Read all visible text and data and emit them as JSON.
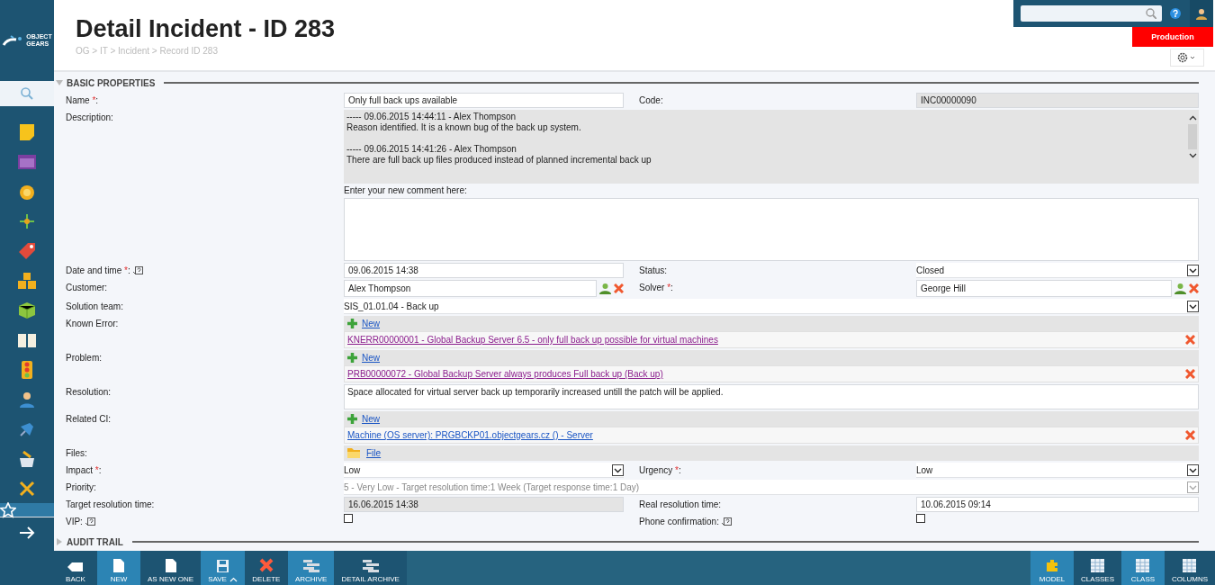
{
  "logo": [
    "OBJECT",
    "GEARS"
  ],
  "header": {
    "title": "Detail Incident - ID 283",
    "breadcrumb": "OG > IT > Incident > Record ID 283",
    "environment": "Production"
  },
  "sidebar_items": [
    {
      "kind": "note",
      "selected": false
    },
    {
      "kind": "window",
      "selected": false
    },
    {
      "kind": "badge",
      "selected": false
    },
    {
      "kind": "network",
      "selected": false
    },
    {
      "kind": "tag",
      "selected": false
    },
    {
      "kind": "boxes",
      "selected": false
    },
    {
      "kind": "cube",
      "selected": false
    },
    {
      "kind": "book",
      "selected": false
    },
    {
      "kind": "traffic",
      "selected": false
    },
    {
      "kind": "person",
      "selected": false
    },
    {
      "kind": "pin",
      "selected": false
    },
    {
      "kind": "tray",
      "selected": false
    },
    {
      "kind": "tools",
      "selected": false
    },
    {
      "kind": "star",
      "selected": true
    },
    {
      "kind": "arrow",
      "selected": false
    }
  ],
  "sections": [
    {
      "title": "BASIC PROPERTIES",
      "expanded": true
    },
    {
      "title": "AUDIT TRAIL",
      "expanded": false
    }
  ],
  "rows": [
    {
      "kind": "pair",
      "fields": [
        {
          "label_parts": [
            {
              "kind": "text",
              "text": "Name "
            },
            {
              "kind": "required",
              "text": "*"
            },
            {
              "kind": "text",
              "text": ":"
            }
          ],
          "kind": "text",
          "value": "Only full back ups available"
        },
        {
          "label_parts": [
            {
              "kind": "text",
              "text": "Code:"
            }
          ],
          "kind": "readonly",
          "value": "INC00000090"
        }
      ]
    },
    {
      "kind": "wide",
      "fields": [
        {
          "label_parts": [
            {
              "kind": "text",
              "text": "Description:"
            }
          ],
          "kind": "history",
          "entries": [
            {
              "header": "----- 09.06.2015 14:44:11 - Alex Thompson",
              "text": "Reason identified. It is a known bug of the back up system."
            },
            {
              "header": "----- 09.06.2015 14:41:26 - Alex Thompson",
              "text": "There are full back up files produced instead of planned incremental back up"
            }
          ],
          "comment_label": "Enter your new comment here:"
        }
      ]
    },
    {
      "kind": "pair",
      "fields": [
        {
          "label_parts": [
            {
              "kind": "text",
              "text": "Date and time "
            },
            {
              "kind": "required",
              "text": "*"
            },
            {
              "kind": "text",
              "text": ":"
            }
          ],
          "help": true,
          "kind": "text",
          "value": "09.06.2015 14:38"
        },
        {
          "label_parts": [
            {
              "kind": "text",
              "text": "Status:"
            }
          ],
          "kind": "select",
          "value": "Closed",
          "disabled": false
        }
      ]
    },
    {
      "kind": "pair",
      "fields": [
        {
          "label_parts": [
            {
              "kind": "text",
              "text": "Customer:"
            }
          ],
          "kind": "lookup",
          "value": "Alex Thompson"
        },
        {
          "label_parts": [
            {
              "kind": "text",
              "text": "Solver "
            },
            {
              "kind": "required",
              "text": "*"
            },
            {
              "kind": "text",
              "text": ":"
            }
          ],
          "kind": "lookup",
          "value": "George Hill"
        }
      ]
    },
    {
      "kind": "wide",
      "fields": [
        {
          "label_parts": [
            {
              "kind": "text",
              "text": "Solution team:"
            }
          ],
          "kind": "select",
          "value": "SIS_01.01.04 - Back up",
          "disabled": false
        }
      ]
    },
    {
      "kind": "wide",
      "fields": [
        {
          "label_parts": [
            {
              "kind": "text",
              "text": "Known Error:"
            }
          ],
          "kind": "relation",
          "new_label": "New",
          "link": "KNERR00000001 - Global Backup Server 6.5 - only full back up possible for virtual machines",
          "visited": true
        }
      ]
    },
    {
      "kind": "wide",
      "fields": [
        {
          "label_parts": [
            {
              "kind": "text",
              "text": "Problem:"
            }
          ],
          "kind": "relation",
          "new_label": "New",
          "link": "PRB00000072 - Global Backup Server always produces Full back up (Back up)",
          "visited": true
        }
      ]
    },
    {
      "kind": "wide",
      "fields": [
        {
          "label_parts": [
            {
              "kind": "text",
              "text": "Resolution:"
            }
          ],
          "kind": "textarea",
          "value": "Space allocated for virtual server back up temporarily increased untill the patch will be applied."
        }
      ]
    },
    {
      "kind": "wide",
      "fields": [
        {
          "label_parts": [
            {
              "kind": "text",
              "text": "Related CI:"
            }
          ],
          "kind": "relation",
          "new_label": "New",
          "link": "Machine (OS server): PRGBCKP01.objectgears.cz () - Server",
          "visited": false
        }
      ]
    },
    {
      "kind": "wide",
      "fields": [
        {
          "label_parts": [
            {
              "kind": "text",
              "text": "Files:"
            }
          ],
          "kind": "files",
          "value": "File"
        }
      ]
    },
    {
      "kind": "pair",
      "fields": [
        {
          "label_parts": [
            {
              "kind": "text",
              "text": "Impact "
            },
            {
              "kind": "required",
              "text": "*"
            },
            {
              "kind": "text",
              "text": ":"
            }
          ],
          "kind": "select",
          "value": "Low",
          "disabled": false
        },
        {
          "label_parts": [
            {
              "kind": "text",
              "text": "Urgency "
            },
            {
              "kind": "required",
              "text": "*"
            },
            {
              "kind": "text",
              "text": ":"
            }
          ],
          "kind": "select",
          "value": "Low",
          "disabled": false
        }
      ]
    },
    {
      "kind": "wide",
      "fields": [
        {
          "label_parts": [
            {
              "kind": "text",
              "text": "Priority:"
            }
          ],
          "kind": "select",
          "value": "5 - Very Low - Target resolution time:1 Week (Target response time:1 Day)",
          "disabled": true
        }
      ]
    },
    {
      "kind": "pair",
      "fields": [
        {
          "label_parts": [
            {
              "kind": "text",
              "text": "Target resolution time:"
            }
          ],
          "kind": "readonly",
          "value": "16.06.2015 14:38"
        },
        {
          "label_parts": [
            {
              "kind": "text",
              "text": "Real resolution time:"
            }
          ],
          "kind": "text",
          "value": "10.06.2015 09:14"
        }
      ]
    },
    {
      "kind": "pair",
      "fields": [
        {
          "label_parts": [
            {
              "kind": "text",
              "text": "VIP: "
            }
          ],
          "help": true,
          "kind": "checkbox",
          "checked": false
        },
        {
          "label_parts": [
            {
              "kind": "text",
              "text": "Phone confirmation: "
            }
          ],
          "help": true,
          "kind": "checkbox",
          "checked": false
        }
      ]
    }
  ],
  "toolbar_left": [
    {
      "kind": "back",
      "label": "BACK"
    },
    {
      "kind": "page",
      "label": "NEW"
    },
    {
      "kind": "page",
      "label": "AS NEW ONE"
    },
    {
      "kind": "save",
      "label": "SAVE"
    },
    {
      "kind": "delete",
      "label": "DELETE"
    },
    {
      "kind": "archive",
      "label": "ARCHIVE"
    },
    {
      "kind": "archive",
      "label": "DETAIL ARCHIVE"
    }
  ],
  "toolbar_right": [
    {
      "kind": "puzzle",
      "label": "MODEL"
    },
    {
      "kind": "grid",
      "label": "CLASSES"
    },
    {
      "kind": "grid",
      "label": "CLASS"
    },
    {
      "kind": "grid",
      "label": "COLUMNS"
    }
  ]
}
